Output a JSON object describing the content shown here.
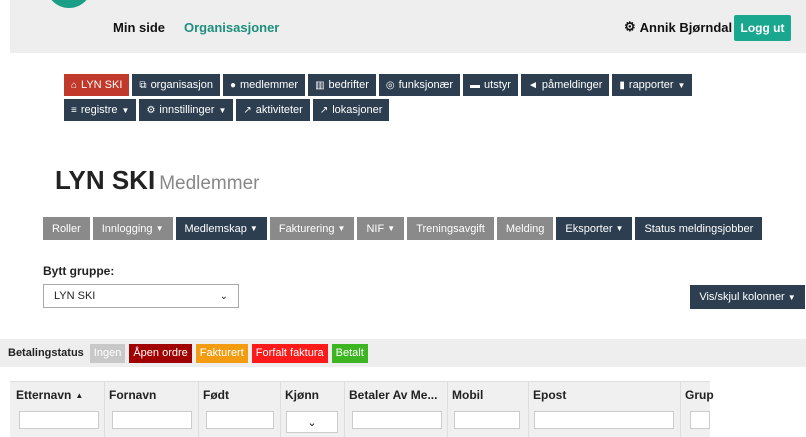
{
  "topbar": {
    "nav": [
      "Min side",
      "Organisasjoner"
    ],
    "user_name": "Annik Bjørndal",
    "logout_label": "Logg ut"
  },
  "mainnav": {
    "row1": [
      {
        "label": "LYN SKI",
        "icon": "home-icon"
      },
      {
        "label": "organisasjon",
        "icon": "sitemap-icon"
      },
      {
        "label": "medlemmer",
        "icon": "users-icon"
      },
      {
        "label": "bedrifter",
        "icon": "bank-icon"
      },
      {
        "label": "funksjonær",
        "icon": "binoculars-icon"
      },
      {
        "label": "utstyr",
        "icon": "car-icon"
      },
      {
        "label": "påmeldinger",
        "icon": "bullhorn-icon"
      },
      {
        "label": "rapporter",
        "icon": "chart-icon"
      }
    ],
    "row2": [
      {
        "label": "registre",
        "icon": "database-icon"
      },
      {
        "label": "innstillinger",
        "icon": "cog-icon"
      },
      {
        "label": "aktiviteter",
        "icon": "external-link-icon"
      },
      {
        "label": "lokasjoner",
        "icon": "external-link-icon"
      }
    ]
  },
  "page": {
    "title": "LYN SKI",
    "subtitle": "Medlemmer"
  },
  "subnav": [
    {
      "label": "Roller"
    },
    {
      "label": "Innlogging"
    },
    {
      "label": "Medlemskap"
    },
    {
      "label": "Fakturering"
    },
    {
      "label": "NIF"
    },
    {
      "label": "Treningsavgift"
    },
    {
      "label": "Melding"
    },
    {
      "label": "Eksporter"
    },
    {
      "label": "Status meldingsjobber"
    }
  ],
  "group": {
    "label": "Bytt gruppe:",
    "selected": "LYN SKI"
  },
  "columns_button": "Vis/skjul kolonner",
  "payment": {
    "label": "Betalingstatus",
    "tags": [
      {
        "label": "Ingen",
        "color": "#c8c8c8"
      },
      {
        "label": "Åpen ordre",
        "color": "#a10000"
      },
      {
        "label": "Fakturert",
        "color": "#f39c12"
      },
      {
        "label": "Forfalt faktura",
        "color": "#ff1a1a"
      },
      {
        "label": "Betalt",
        "color": "#3cb521"
      }
    ]
  },
  "table": {
    "headers": [
      "Etternavn",
      "Fornavn",
      "Født",
      "Kjønn",
      "Betaler Av Me...",
      "Mobil",
      "Epost",
      "Grup"
    ]
  }
}
